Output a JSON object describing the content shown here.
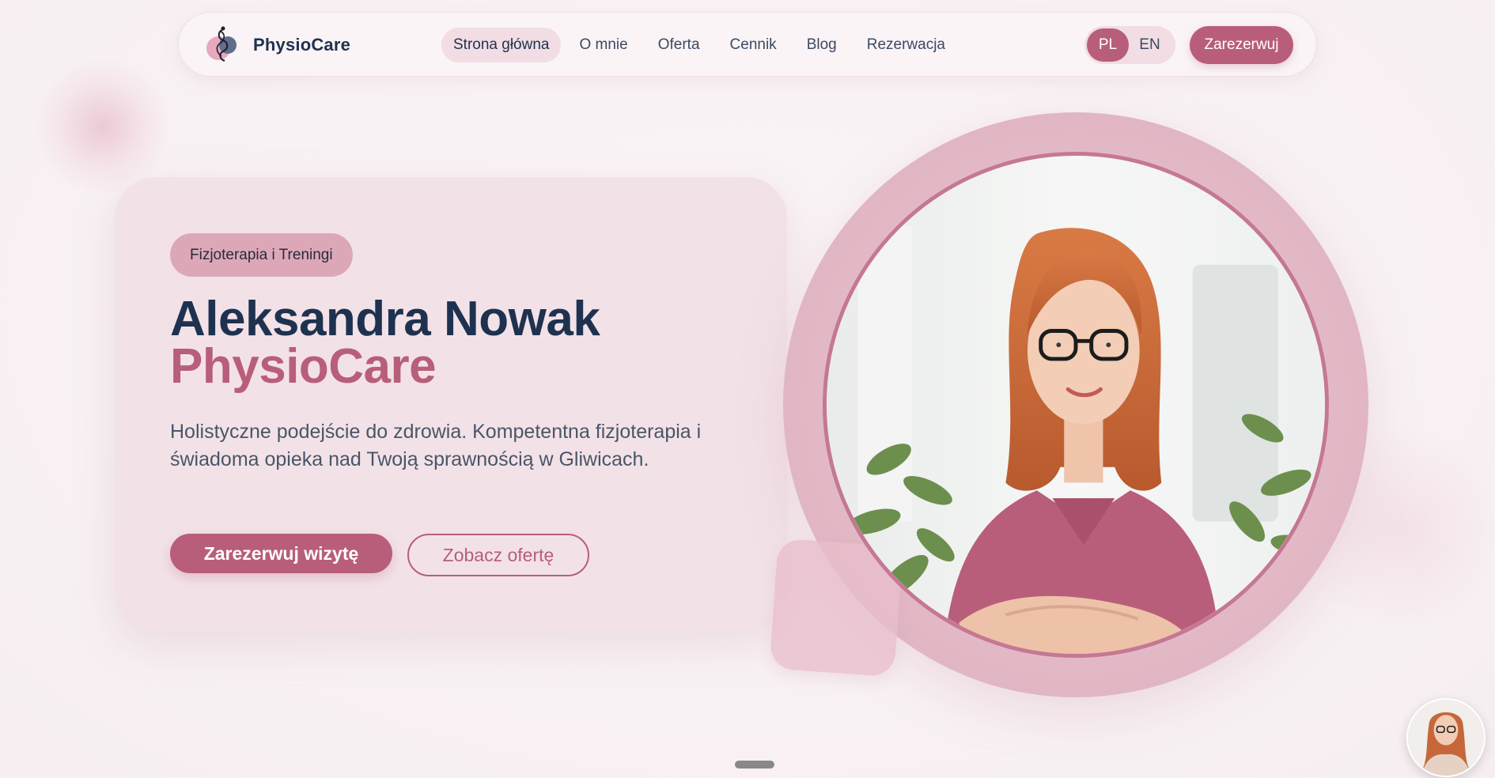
{
  "brand": {
    "name": "PhysioCare"
  },
  "nav": {
    "links": [
      {
        "label": "Strona główna",
        "active": true
      },
      {
        "label": "O mnie"
      },
      {
        "label": "Oferta"
      },
      {
        "label": "Cennik"
      },
      {
        "label": "Blog"
      },
      {
        "label": "Rezerwacja"
      }
    ],
    "languages": [
      {
        "label": "PL",
        "active": true
      },
      {
        "label": "EN"
      }
    ],
    "cta_label": "Zarezerwuj"
  },
  "hero": {
    "tag": "Fizjoterapia i Treningi",
    "title_line1": "Aleksandra Nowak",
    "title_line2": "PhysioCare",
    "description": "Holistyczne podejście do zdrowia. Kompetentna fizjoterapia i świadoma opieka nad Twoją sprawnością w Gliwicach.",
    "primary_button": "Zarezerwuj wizytę",
    "secondary_button": "Zobacz ofertę"
  },
  "colors": {
    "accent": "#b85e7a",
    "navy": "#1e3250",
    "card_bg": "#f2e2e7",
    "tag_bg": "#dca8b8",
    "page_bg": "#f9f2f4"
  },
  "icons": {
    "logo": "physio-figure-icon",
    "portrait": "therapist-portrait",
    "chat_avatar": "therapist-avatar"
  }
}
